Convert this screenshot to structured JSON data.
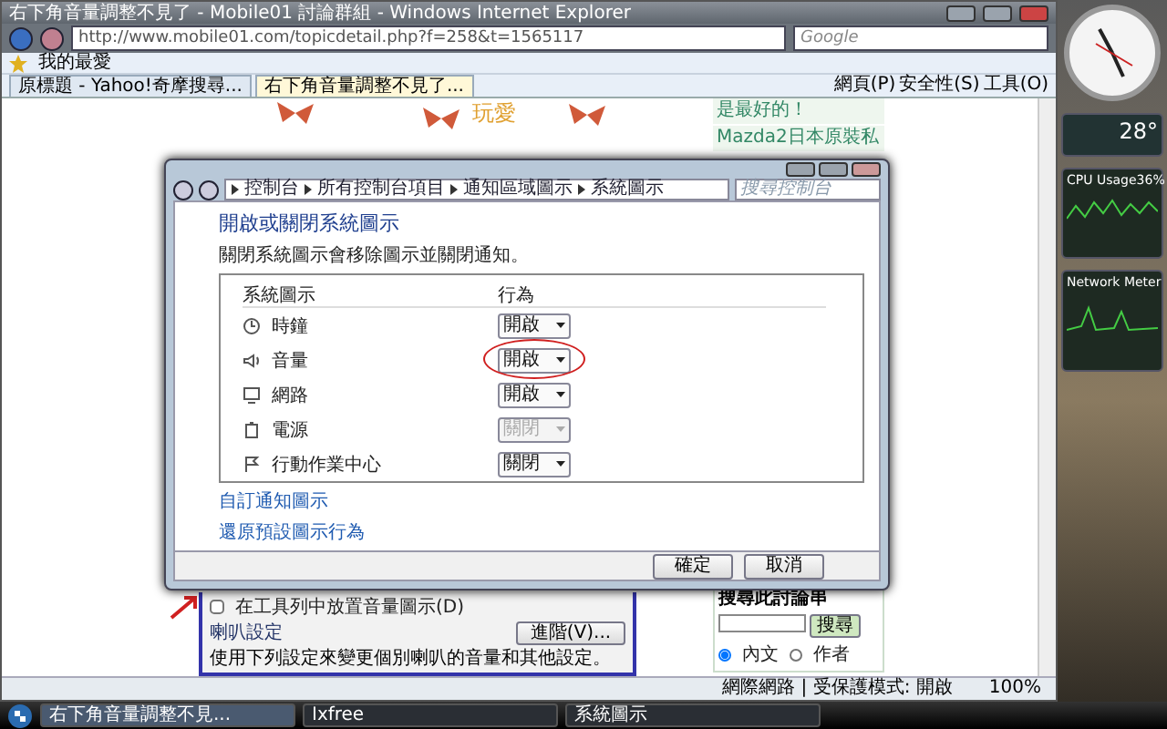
{
  "browser": {
    "title": "右下角音量調整不見了 - Mobile01 討論群組 - Windows Internet Explorer",
    "address": "http://www.mobile01.com/topicdetail.php?f=258&t=1565117",
    "search_placeholder": "Google",
    "favorites": "我的最愛",
    "tabs": [
      {
        "label": "原標題 - Yahoo!奇摩搜尋...",
        "selected": false
      },
      {
        "label": "右下角音量調整不見了...",
        "selected": true
      }
    ],
    "commands": [
      "網頁(P)",
      "安全性(S)",
      "工具(O)"
    ],
    "status": "網際網路 | 受保護模式: 開啟",
    "zoom": "100%"
  },
  "page": {
    "banner": "玩愛",
    "sidebar_items": [
      "是最好的！",
      "Mazda2日本原裝私"
    ],
    "checkbox": {
      "label": "在工具列中放置音量圖示(D)",
      "checked": false
    },
    "advanced_button": "進階(V)...",
    "speaker_title": "喇叭設定",
    "speaker_text": "使用下列設定來變更個別喇叭的音量和其他設定。",
    "search_title": "搜尋此討論串",
    "search_button": "搜尋",
    "search_options": [
      {
        "label": "內文",
        "selected": true
      },
      {
        "label": "作者",
        "selected": false
      }
    ]
  },
  "dialog": {
    "breadcrumb": [
      "控制台",
      "所有控制台項目",
      "通知區域圖示",
      "系統圖示"
    ],
    "search_placeholder": "搜尋控制台",
    "heading": "開啟或關閉系統圖示",
    "description": "關閉系統圖示會移除圖示並關閉通知。",
    "columns": [
      "系統圖示",
      "行為"
    ],
    "rows": [
      {
        "name": "時鐘",
        "behavior": "開啟",
        "disabled": false,
        "circled": false
      },
      {
        "name": "音量",
        "behavior": "開啟",
        "disabled": false,
        "circled": true
      },
      {
        "name": "網路",
        "behavior": "開啟",
        "disabled": false,
        "circled": false
      },
      {
        "name": "電源",
        "behavior": "關閉",
        "disabled": true,
        "circled": false
      },
      {
        "name": "行動作業中心",
        "behavior": "關閉",
        "disabled": false,
        "circled": false
      }
    ],
    "links": [
      "自訂通知圖示",
      "還原預設圖示行為"
    ],
    "buttons": [
      "確定",
      "取消"
    ]
  },
  "gadgets": {
    "weather": "28°",
    "cpu_title": "CPU Usage",
    "cpu_value": "36%",
    "network_title": "Network Meter"
  },
  "taskbar": {
    "items": [
      {
        "label": "右下角音量調整不見...",
        "selected": true
      },
      {
        "label": "Ixfree",
        "selected": false
      },
      {
        "label": "系統圖示",
        "selected": false
      }
    ]
  }
}
